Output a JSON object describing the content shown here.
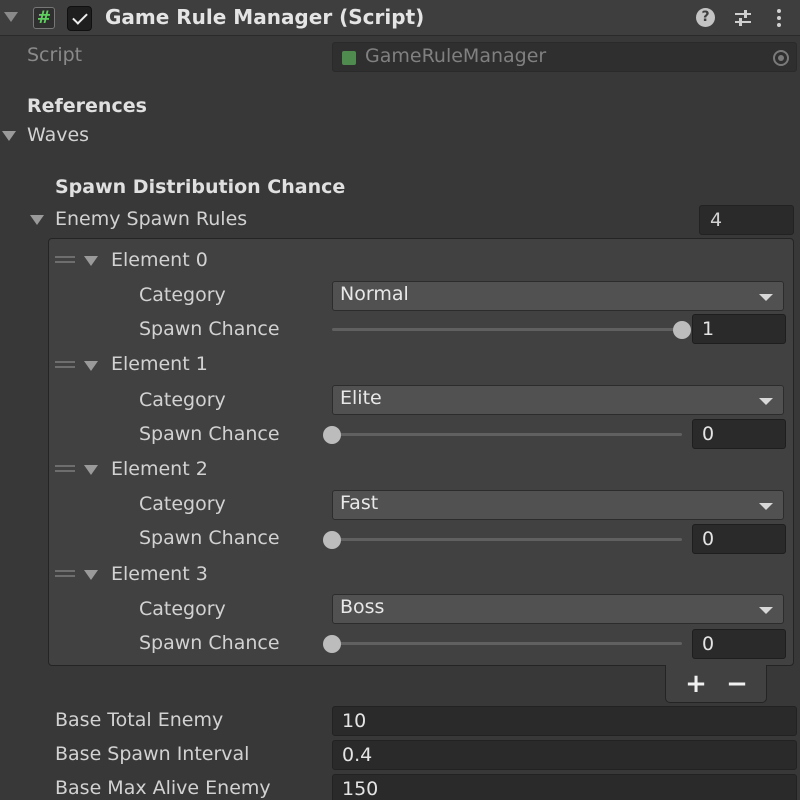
{
  "header": {
    "title": "Game Rule Manager (Script)",
    "script_icon_glyph": "#",
    "help_glyph": "?",
    "menu_glyph": "⋮"
  },
  "script_field": {
    "label": "Script",
    "value": "GameRuleManager"
  },
  "references_header": "References",
  "waves_label": "Waves",
  "spawn_distribution_header": "Spawn Distribution Chance",
  "enemy_spawn_rules": {
    "label": "Enemy Spawn Rules",
    "size": "4",
    "elements": [
      {
        "label": "Element 0",
        "category_label": "Category",
        "category": "Normal",
        "chance_label": "Spawn Chance",
        "chance": "1",
        "chance_fraction": 1
      },
      {
        "label": "Element 1",
        "category_label": "Category",
        "category": "Elite",
        "chance_label": "Spawn Chance",
        "chance": "0",
        "chance_fraction": 0
      },
      {
        "label": "Element 2",
        "category_label": "Category",
        "category": "Fast",
        "chance_label": "Spawn Chance",
        "chance": "0",
        "chance_fraction": 0
      },
      {
        "label": "Element 3",
        "category_label": "Category",
        "category": "Boss",
        "chance_label": "Spawn Chance",
        "chance": "0",
        "chance_fraction": 0
      }
    ],
    "add_glyph": "+",
    "remove_glyph": "−"
  },
  "fields": [
    {
      "label": "Base Total Enemy",
      "value": "10"
    },
    {
      "label": "Base Spawn Interval",
      "value": "0.4"
    },
    {
      "label": "Base Max Alive Enemy",
      "value": "150"
    }
  ],
  "colors": {
    "background": "#383838",
    "header_bg": "#3e3e3e",
    "script_icon_green": "#5fd05f"
  },
  "icons": [
    "script-hash-icon",
    "checkbox-checked-icon",
    "help-icon",
    "presets-icon",
    "kebab-menu-icon",
    "object-picker-icon",
    "foldout-arrow-icon",
    "drag-handle-icon",
    "dropdown-arrow-icon"
  ]
}
